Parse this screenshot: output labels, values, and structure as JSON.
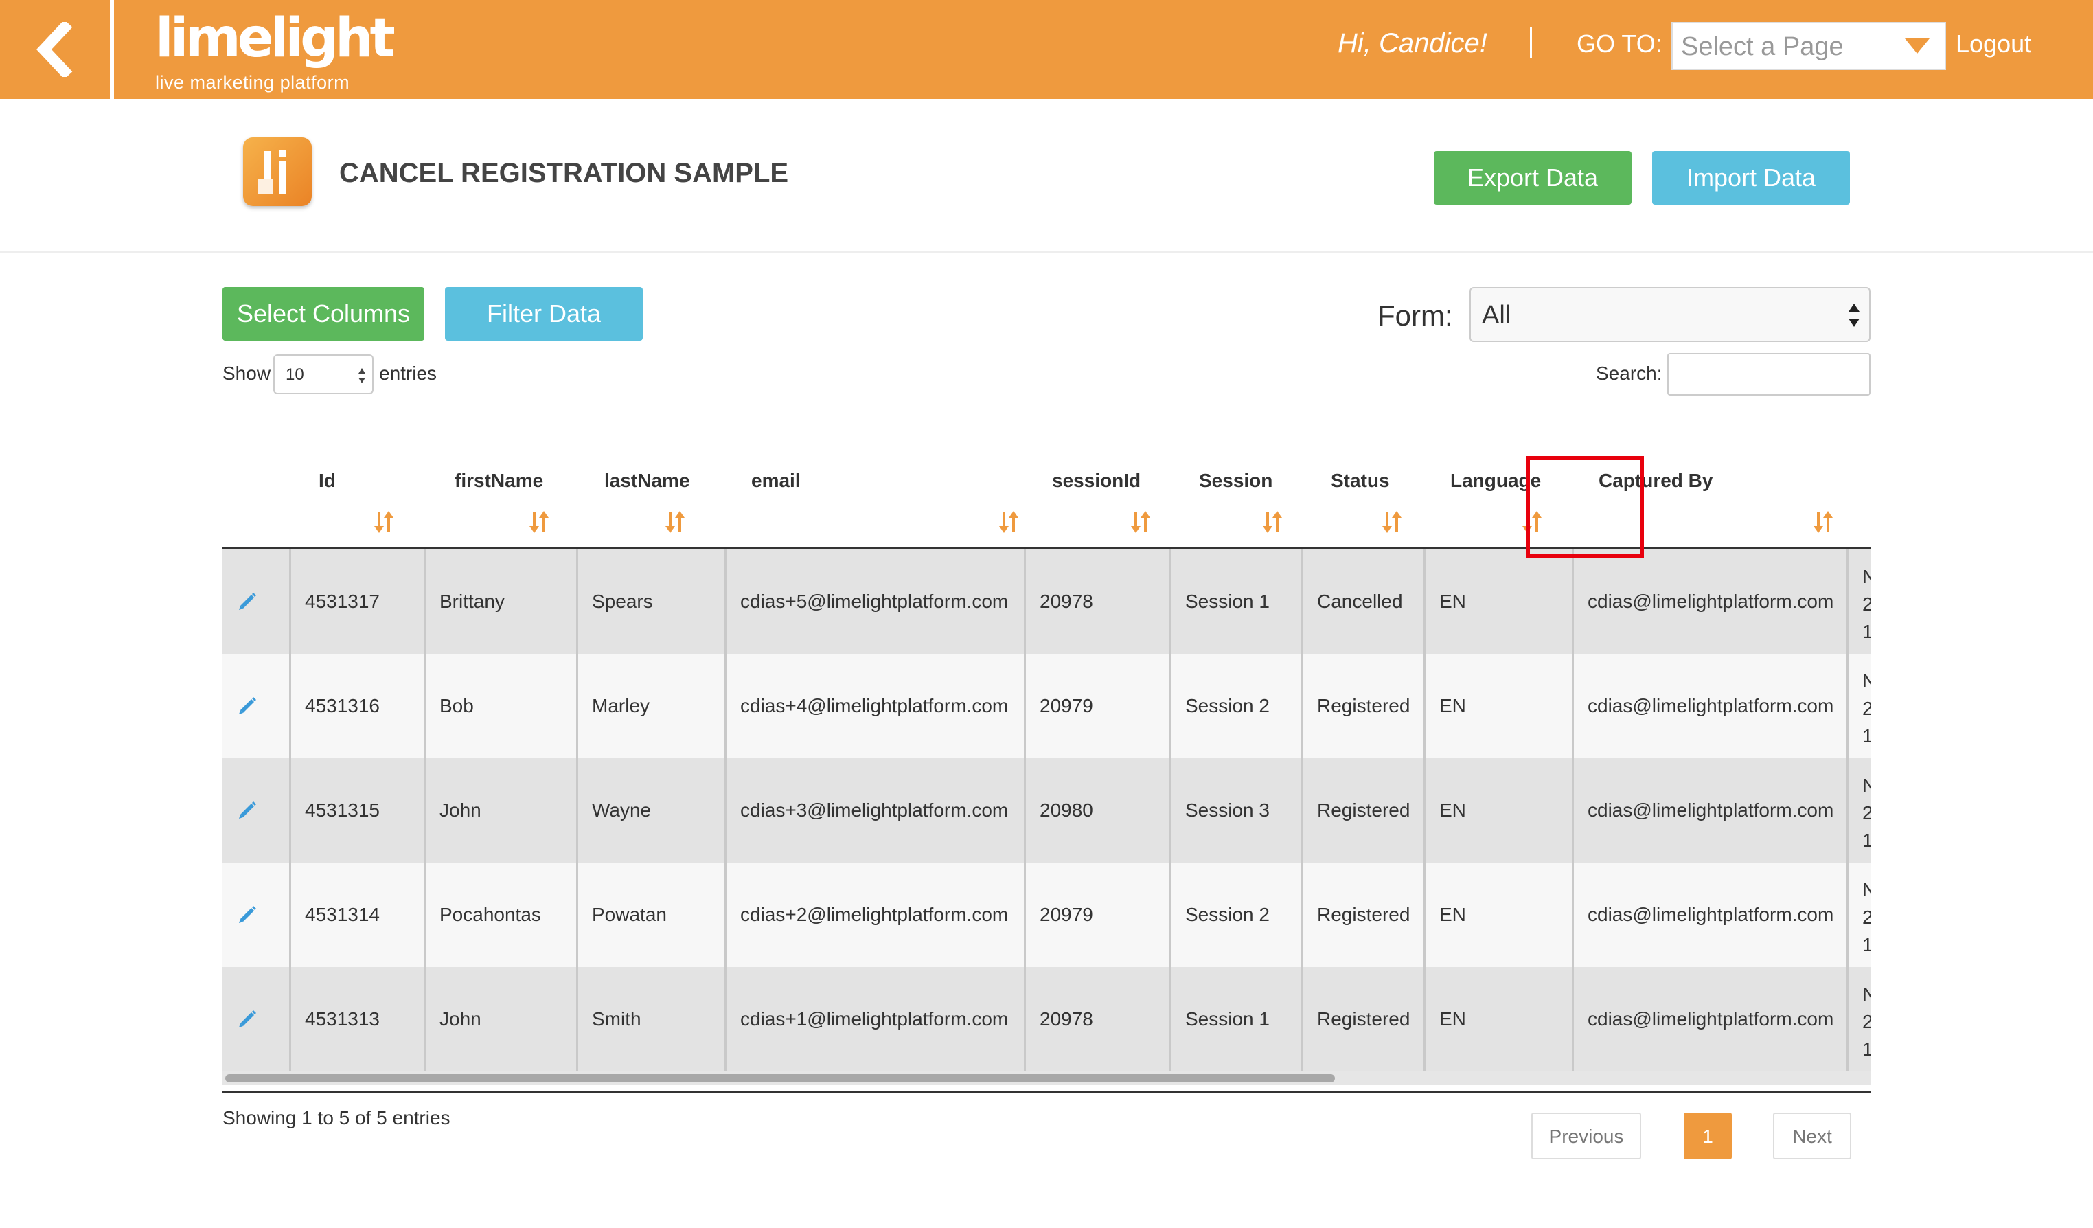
{
  "header": {
    "logo_word": "limelight",
    "logo_tagline": "live marketing platform",
    "greeting": "Hi,  Candice!",
    "goto_label": "GO TO:",
    "goto_placeholder": "Select a Page",
    "logout_label": "Logout",
    "brand_color": "#ef9a3e"
  },
  "page": {
    "title": "CANCEL REGISTRATION SAMPLE",
    "export_label": "Export Data",
    "import_label": "Import Data"
  },
  "toolbar": {
    "select_columns_label": "Select Columns",
    "filter_label": "Filter Data",
    "form_label": "Form:",
    "form_value": "All",
    "show_label": "Show",
    "show_value": "10",
    "entries_label": "entries",
    "search_label": "Search:",
    "search_value": ""
  },
  "table": {
    "columns": [
      "Id",
      "firstName",
      "lastName",
      "email",
      "sessionId",
      "Session",
      "Status",
      "Language",
      "Captured By"
    ],
    "rows": [
      {
        "id": "4531317",
        "firstName": "Brittany",
        "lastName": "Spears",
        "email": "cdias+5@limelightplatform.com",
        "sessionId": "20978",
        "session": "Session 1",
        "status": "Cancelled",
        "language": "EN",
        "capturedBy": "cdias@limelightplatform.com",
        "extra": "N\n2\n1"
      },
      {
        "id": "4531316",
        "firstName": "Bob",
        "lastName": "Marley",
        "email": "cdias+4@limelightplatform.com",
        "sessionId": "20979",
        "session": "Session 2",
        "status": "Registered",
        "language": "EN",
        "capturedBy": "cdias@limelightplatform.com",
        "extra": "N\n2\n1"
      },
      {
        "id": "4531315",
        "firstName": "John",
        "lastName": "Wayne",
        "email": "cdias+3@limelightplatform.com",
        "sessionId": "20980",
        "session": "Session 3",
        "status": "Registered",
        "language": "EN",
        "capturedBy": "cdias@limelightplatform.com",
        "extra": "N\n2\n1"
      },
      {
        "id": "4531314",
        "firstName": "Pocahontas",
        "lastName": "Powatan",
        "email": "cdias+2@limelightplatform.com",
        "sessionId": "20979",
        "session": "Session 2",
        "status": "Registered",
        "language": "EN",
        "capturedBy": "cdias@limelightplatform.com",
        "extra": "N\n2\n1"
      },
      {
        "id": "4531313",
        "firstName": "John",
        "lastName": "Smith",
        "email": "cdias+1@limelightplatform.com",
        "sessionId": "20978",
        "session": "Session 1",
        "status": "Registered",
        "language": "EN",
        "capturedBy": "cdias@limelightplatform.com",
        "extra": "N\n2\n1"
      }
    ],
    "highlight_color": "#e8000d"
  },
  "footer": {
    "info": "Showing 1 to 5 of 5 entries",
    "previous_label": "Previous",
    "current_page": "1",
    "next_label": "Next"
  },
  "icons": {
    "back": "chevron-left-icon",
    "edit": "pencil-icon",
    "sort": "sort-icon",
    "app": "limelight-app-icon"
  }
}
